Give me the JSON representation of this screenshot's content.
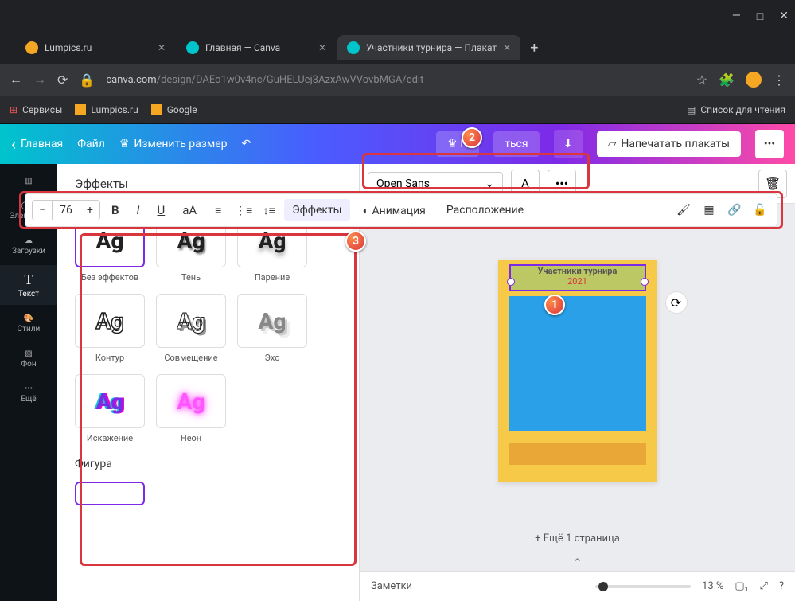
{
  "browser": {
    "tabs": [
      {
        "title": "Lumpics.ru",
        "icon_color": "#f5a623"
      },
      {
        "title": "Главная — Canva",
        "icon_color": "#00c4cc"
      },
      {
        "title": "Участники турнира — Плакат",
        "icon_color": "#00c4cc"
      }
    ],
    "url_host": "canva.com",
    "url_path": "/design/DAEo1w0v4nc/GuHELUej3AzxAwVVovbMGA/edit",
    "bookmarks": {
      "services": "Сервисы",
      "lumpics": "Lumpics.ru",
      "google": "Google",
      "reading": "Список для чтения"
    }
  },
  "header": {
    "home": "Главная",
    "file": "Файл",
    "resize": "Изменить размер",
    "share_prefix": "П",
    "share_suffix": "ться",
    "print": "Напечатать плакаты"
  },
  "sidebar": {
    "items": [
      {
        "label": "Шаблоны"
      },
      {
        "label": "Элементы"
      },
      {
        "label": "Загрузки"
      },
      {
        "label": "Текст"
      },
      {
        "label": "Стили"
      },
      {
        "label": "Фон"
      },
      {
        "label": "Ещё"
      }
    ]
  },
  "panel": {
    "title": "Эффекты",
    "effects": [
      {
        "label": "Без эффектов"
      },
      {
        "label": "Тень"
      },
      {
        "label": "Парение"
      },
      {
        "label": "Контур"
      },
      {
        "label": "Совмещение"
      },
      {
        "label": "Эхо"
      },
      {
        "label": "Искажение"
      },
      {
        "label": "Неон"
      }
    ],
    "section2": "Фигура"
  },
  "toolbar": {
    "font": "Open Sans",
    "size": "76",
    "effects": "Эффекты",
    "animation": "Анимация",
    "position": "Расположение"
  },
  "canvas": {
    "title_line1": "Участники турнира",
    "title_line2": "2021",
    "add_page": "+ Ещё 1 страница"
  },
  "footer": {
    "notes": "Заметки",
    "zoom": "13 %"
  },
  "markers": {
    "m1": "1",
    "m2": "2",
    "m3": "3"
  }
}
